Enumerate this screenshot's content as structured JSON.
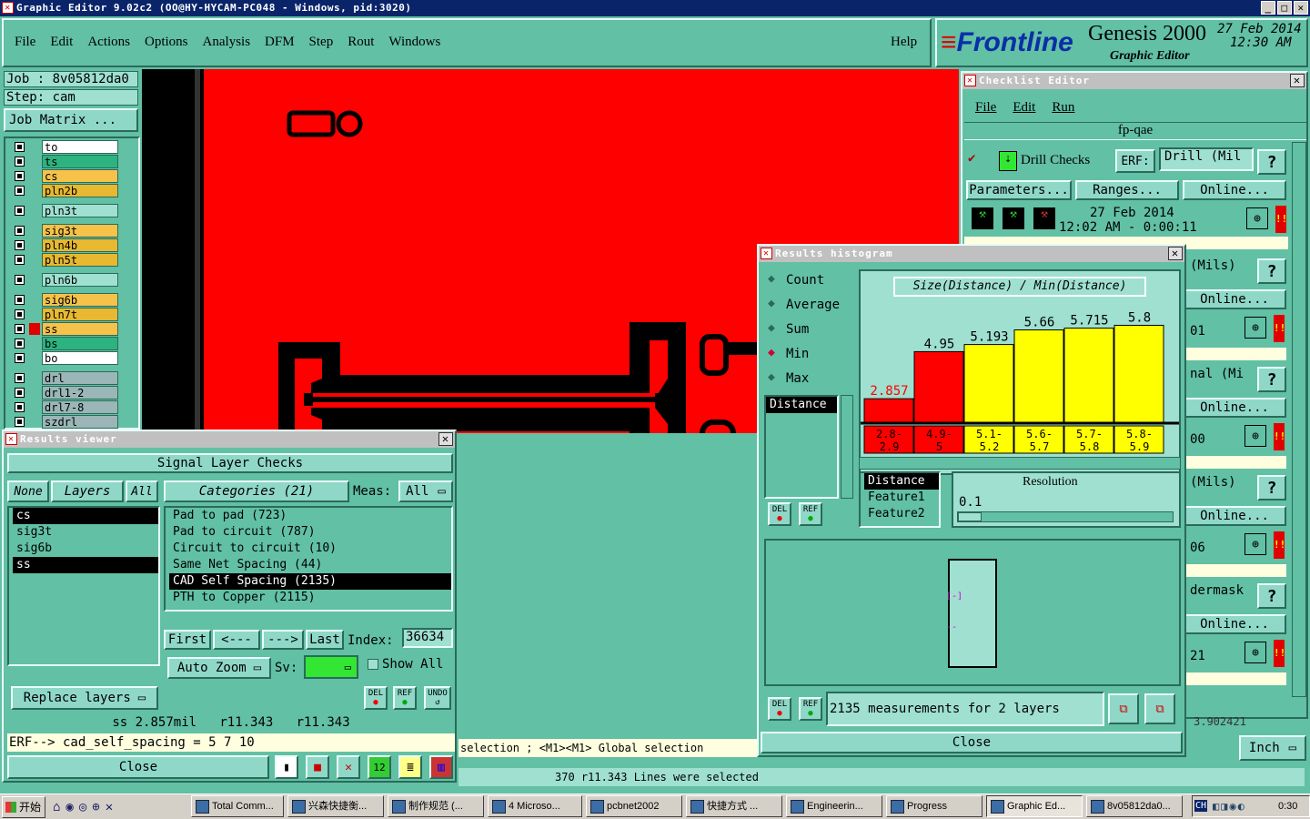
{
  "window": {
    "title": "Graphic Editor 9.02c2 (OO@HY-HYCAM-PC048 - Windows, pid:3020)"
  },
  "menu": [
    "File",
    "Edit",
    "Actions",
    "Options",
    "Analysis",
    "DFM",
    "Step",
    "Rout",
    "Windows"
  ],
  "help": "Help",
  "brand": {
    "logo": "Frontline",
    "product": "Genesis 2000",
    "date": "27 Feb 2014",
    "time": "12:30 AM",
    "sub": "Graphic Editor"
  },
  "job": {
    "job": "Job : 8v05812da0",
    "step": "Step: cam",
    "matrix": "Job Matrix ..."
  },
  "layers": [
    {
      "name": "to",
      "color": "#ffffff"
    },
    {
      "name": "ts",
      "color": "#2db37f"
    },
    {
      "name": "cs",
      "color": "#f6c24a"
    },
    {
      "name": "pln2b",
      "color": "#e8b830"
    },
    {
      "name": "pln3t",
      "color": "#9fe0d0"
    },
    {
      "name": "sig3t",
      "color": "#f6c24a"
    },
    {
      "name": "pln4b",
      "color": "#e8b830"
    },
    {
      "name": "pln5t",
      "color": "#e8b830"
    },
    {
      "name": "pln6b",
      "color": "#9fe0d0"
    },
    {
      "name": "sig6b",
      "color": "#f6c24a"
    },
    {
      "name": "pln7t",
      "color": "#e8b830"
    },
    {
      "name": "ss",
      "color": "#f6c24a"
    },
    {
      "name": "bs",
      "color": "#2db37f"
    },
    {
      "name": "bo",
      "color": "#ffffff"
    },
    {
      "name": "drl",
      "color": "#9ab6b6"
    },
    {
      "name": "drl1-2",
      "color": "#9ab6b6"
    },
    {
      "name": "drl7-8",
      "color": "#9ab6b6"
    },
    {
      "name": "szdrl",
      "color": "#9ab6b6"
    }
  ],
  "results_viewer": {
    "title": "Results viewer",
    "header": "Signal Layer Checks",
    "none": "None",
    "layers_label": "Layers",
    "all": "All",
    "layers": [
      "cs",
      "sig3t",
      "sig6b",
      "ss"
    ],
    "categories_label": "Categories (21)",
    "meas_label": "Meas:",
    "meas_value": "All",
    "categories": [
      "Pad to pad (723)",
      "Pad to circuit (787)",
      "Circuit to circuit (10)",
      "Same Net Spacing (44)",
      "CAD Self Spacing (2135)",
      "PTH to Copper (2115)"
    ],
    "first": "First",
    "prev": "<---",
    "next": "--->",
    "last": "Last",
    "index_label": "Index:",
    "index_value": "36634",
    "auto_zoom": "Auto Zoom",
    "sv": "Sv:",
    "show_all": "Show All",
    "replace": "Replace layers",
    "del": "DEL",
    "ref": "REF",
    "undo": "UNDO",
    "status": "ss 2.857mil   r11.343   r11.343",
    "erf": "ERF--> cad_self_spacing = 5 7 10",
    "close": "Close"
  },
  "checklist": {
    "title": "Checklist Editor",
    "menu": [
      "File",
      "Edit",
      "Run"
    ],
    "name": "fp-qae",
    "drill": "Drill Checks",
    "erf": "ERF:",
    "erf_value": "Drill (Mil",
    "parameters": "Parameters...",
    "ranges": "Ranges...",
    "online": "Online...",
    "date": "27 Feb 2014",
    "time": "12:02 AM - 0:00:11",
    "rows": [
      {
        "label": "(Mils)",
        "val": "01"
      },
      {
        "label": "nal (Mi",
        "val": "00"
      },
      {
        "label": "(Mils)",
        "val": "06"
      },
      {
        "label": "dermask",
        "val": "21"
      }
    ],
    "q": "?",
    "inch": "Inch",
    "partial": "3.902421"
  },
  "histogram": {
    "title": "Results histogram",
    "options": [
      "Count",
      "Average",
      "Sum",
      "Min",
      "Max"
    ],
    "selected": "Min",
    "caption": "Size(Distance) / Min(Distance)",
    "distance": "Distance",
    "bars": [
      {
        "label": "2.857",
        "range": [
          "2.8-",
          "2.9"
        ],
        "value": 2.857,
        "color": "#ff0000"
      },
      {
        "label": "4.95",
        "range": [
          "4.9-",
          "5"
        ],
        "value": 4.95,
        "color": "#ff0000"
      },
      {
        "label": "5.193",
        "range": [
          "5.1-",
          "5.2"
        ],
        "value": 5.193,
        "color": "#ffff00"
      },
      {
        "label": "5.66",
        "range": [
          "5.6-",
          "5.7"
        ],
        "value": 5.66,
        "color": "#ffff00"
      },
      {
        "label": "5.715",
        "range": [
          "5.7-",
          "5.8"
        ],
        "value": 5.715,
        "color": "#ffff00"
      },
      {
        "label": "5.8",
        "range": [
          "5.8-",
          "5.9"
        ],
        "value": 5.8,
        "color": "#ffff00"
      }
    ],
    "fields": [
      "Distance",
      "Feature1",
      "Feature2"
    ],
    "resolution": "Resolution",
    "res_value": "0.1",
    "measurements": "2135 measurements for 2 layers",
    "close": "Close"
  },
  "status": {
    "selection": "selection ; <M1><M1> Global selection",
    "lines": "370 r11.343 Lines were selected"
  },
  "taskbar": {
    "start": "开始",
    "items": [
      "Total Comm...",
      "兴森快捷衡...",
      "制作规范 (...",
      "4 Microso...",
      "pcbnet2002",
      "快捷方式 ...",
      "Engineerin...",
      "Progress",
      "Graphic Ed...",
      "8v05812da0..."
    ],
    "clock": "0:30",
    "ch": "CH"
  }
}
